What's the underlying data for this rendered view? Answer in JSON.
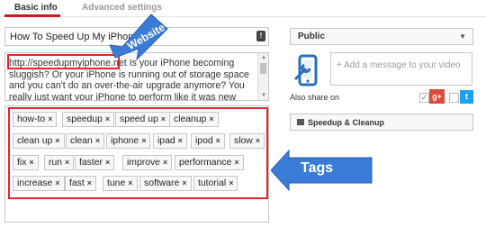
{
  "tabs": [
    {
      "label": "Basic info"
    },
    {
      "label": "Advanced settings"
    }
  ],
  "video": {
    "title": "How To Speed Up My iPhone",
    "description": "http://speedupmyiphone.net  Is your iPhone becoming sluggish? Or your iPhone is running out of storage space and you can't do an over-the-air upgrade anymore? You really just want your iPhone to perform like it was new again. Well, you've come to the right place. All you need is iPhone cleaner software that will clean"
  },
  "annotations": {
    "website_label": "Website",
    "tags_label": "Tags"
  },
  "tags": [
    "how-to",
    "speedup",
    "speed up",
    "cleanup",
    "clean up",
    "clean",
    "iphone",
    "ipad",
    "ipod",
    "slow",
    "fix",
    "run",
    "faster",
    "improve",
    "performance",
    "increase",
    "fast",
    "tune",
    "software",
    "tutorial"
  ],
  "tag_remove_glyph": "×",
  "privacy": {
    "selected": "Public"
  },
  "message": {
    "placeholder": "+ Add a message to your video"
  },
  "share": {
    "label": "Also share on",
    "gplus": "g+",
    "twitter": "t"
  },
  "playlist": {
    "label": "Speedup & Cleanup"
  },
  "colors": {
    "accent": "#cc181e",
    "callout": "#3a7bd5",
    "highlight": "#e0262b"
  },
  "icons": [
    "tag-icon",
    "phone-wrench-icon",
    "checkbox-icon",
    "gplus-icon",
    "twitter-icon",
    "playlist-icon",
    "chevron-down-icon",
    "close-icon"
  ]
}
